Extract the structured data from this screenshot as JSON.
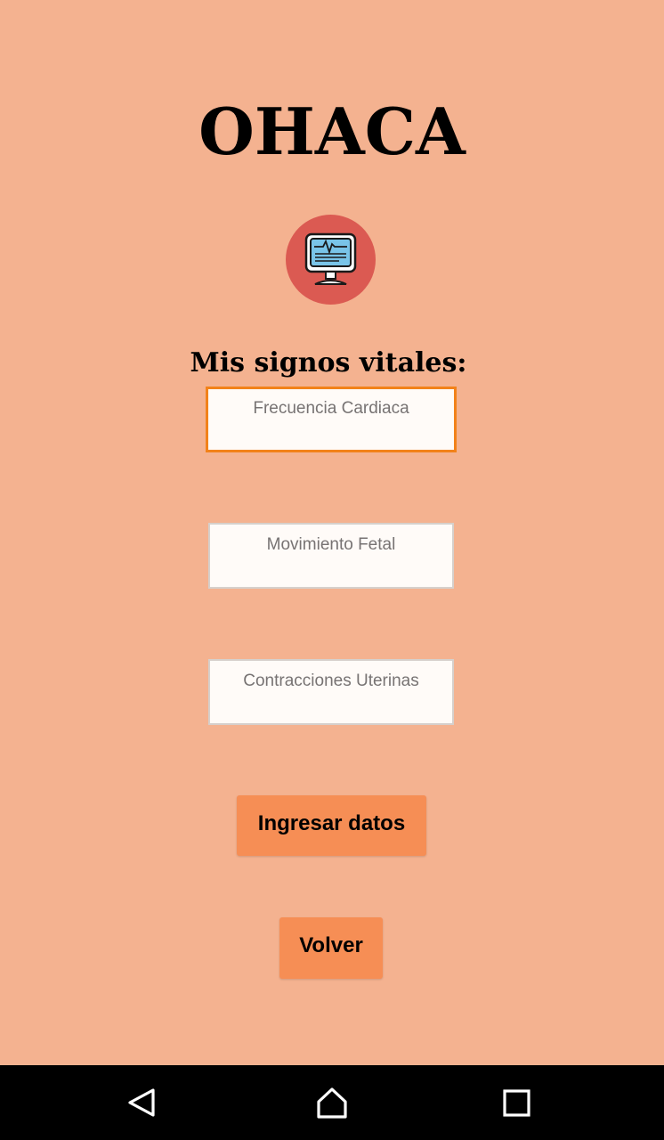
{
  "app": {
    "title": "OHACA",
    "logo_icon": "vital-signs-monitor-icon"
  },
  "form": {
    "section_title": "Mis signos vitales:",
    "fields": [
      {
        "placeholder": "Frecuencia Cardiaca",
        "value": "",
        "focused": true
      },
      {
        "placeholder": "Movimiento Fetal",
        "value": "",
        "focused": false
      },
      {
        "placeholder": "Contracciones Uterinas",
        "value": "",
        "focused": false
      }
    ],
    "submit_label": "Ingresar datos",
    "back_label": "Volver"
  },
  "navbar": {
    "icons": [
      "back-triangle-icon",
      "home-icon",
      "recent-apps-icon"
    ]
  },
  "colors": {
    "background": "#f4b290",
    "button": "#f68e55",
    "logo_circle": "#db5a52",
    "focus_border": "#f2821a",
    "navbar": "#000000"
  }
}
